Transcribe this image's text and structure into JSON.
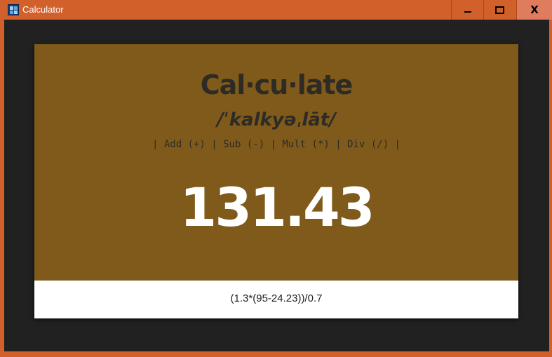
{
  "window": {
    "title": "Calculator",
    "icons": {
      "app": "calculator-icon",
      "minimize": "minimize-icon",
      "maximize": "maximize-icon",
      "close": "close-icon"
    },
    "close_glyph": "X"
  },
  "colors": {
    "titlebar": "#d2602a",
    "client_bg": "#212121",
    "card_top": "#7f5a1b",
    "card_bottom": "#ffffff",
    "result_text": "#ffffff"
  },
  "calculator": {
    "word": "Cal·cu·late",
    "pronunciation": "/ˈkalkyəˌlāt/",
    "operations": "| Add (+) | Sub (-) | Mult (*) | Div (/) |",
    "result": "131.43",
    "expression": "(1.3*(95-24.23))/0.7"
  }
}
